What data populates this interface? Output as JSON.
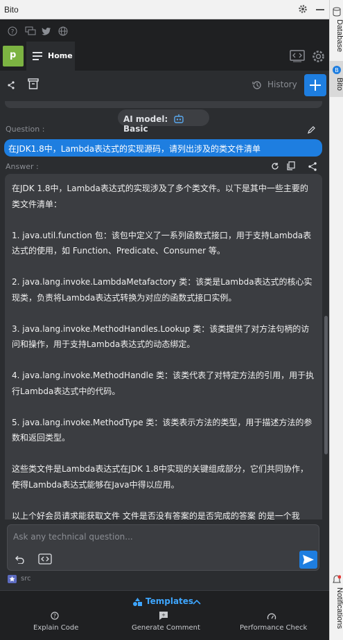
{
  "ide": {
    "panel_title": "Bito",
    "side_tabs": [
      "Database",
      "Bito"
    ],
    "bottom_side_tab": "Notifications"
  },
  "header": {
    "avatar_letter": "p",
    "home_tab": "Home",
    "history_label": "History"
  },
  "chat": {
    "ai_model_label": "AI model:",
    "ai_model_value": "Basic",
    "question_label": "Question :",
    "question_text": "在JDK1.8中，Lambda表达式的实现源码，请列出涉及的类文件清单",
    "answer_label": "Answer :",
    "answer_paragraphs": [
      "在JDK 1.8中，Lambda表达式的实现涉及了多个类文件。以下是其中一些主要的类文件清单：",
      "1. java.util.function 包：该包中定义了一系列函数式接口，用于支持Lambda表达式的使用，如 Function、Predicate、Consumer 等。",
      "2. java.lang.invoke.LambdaMetafactory 类：该类是Lambda表达式的核心实现类，负责将Lambda表达式转换为对应的函数式接口实例。",
      "3. java.lang.invoke.MethodHandles.Lookup 类：该类提供了对方法句柄的访问和操作，用于支持Lambda表达式的动态绑定。",
      "4. java.lang.invoke.MethodHandle 类：该类代表了对特定方法的引用，用于执行Lambda表达式中的代码。",
      "5. java.lang.invoke.MethodType 类：该类表示方法的类型，用于描述方法的参数和返回类型。",
      "这些类文件是Lambda表达式在JDK 1.8中实现的关键组成部分，它们共同协作，使得Lambda表达式能够在Java中得以应用。",
      "以上个好会员请求能获取文件 文件是否没有答案的是否完成的答案 的是一个我"
    ]
  },
  "input": {
    "placeholder": "Ask any technical question...",
    "context_label": "src"
  },
  "footer": {
    "templates_label": "Templates",
    "items": [
      "Explain Code",
      "Generate Comment",
      "Performance Check"
    ]
  },
  "colors": {
    "accent": "#1e7ee0",
    "avatar": "#7cb342",
    "bg": "#2b2d30",
    "bubble": "#3b3d41"
  }
}
